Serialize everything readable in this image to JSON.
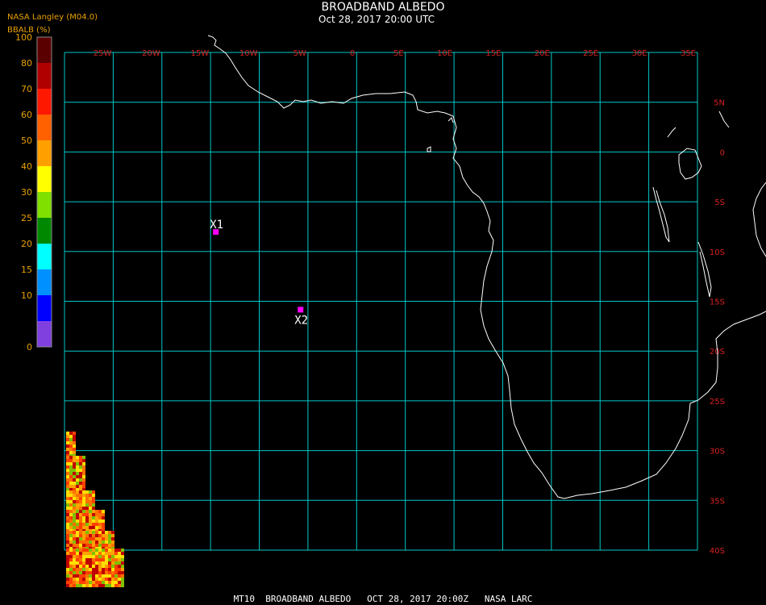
{
  "title": "BROADBAND ALBEDO",
  "subtitle": "Oct 28, 2017 20:00 UTC",
  "source": "NASA Langley (M04.0)",
  "legend": {
    "title": "BBALB (%)",
    "ticks": [
      "100",
      "80",
      "70",
      "60",
      "50",
      "40",
      "30",
      "25",
      "20",
      "15",
      "10",
      "0"
    ],
    "colors": [
      "#5a0000",
      "#b00000",
      "#ff1800",
      "#ff6000",
      "#ffa000",
      "#ffff00",
      "#80e000",
      "#008800",
      "#00ffff",
      "#0090ff",
      "#0000ff",
      "#8040e0"
    ]
  },
  "map": {
    "lon_labels": [
      "25W",
      "20W",
      "15W",
      "10W",
      "5W",
      "0",
      "5E",
      "10E",
      "15E",
      "20E",
      "25E",
      "30E",
      "35E"
    ],
    "lat_labels": [
      "5N",
      "0",
      "5S",
      "10S",
      "15S",
      "20S",
      "25S",
      "30S",
      "35S",
      "40S"
    ],
    "grid_color": "#00c8c8",
    "label_color": "#d82020",
    "coast_color": "#ffffff"
  },
  "markers": [
    {
      "label": "X1",
      "lon": -14.5,
      "lat": -8.0
    },
    {
      "label": "X2",
      "lon": -5.8,
      "lat": -15.8
    }
  ],
  "footer": "MT10  BROADBAND ALBEDO   OCT 28, 2017 20:00Z   NASA LARC"
}
